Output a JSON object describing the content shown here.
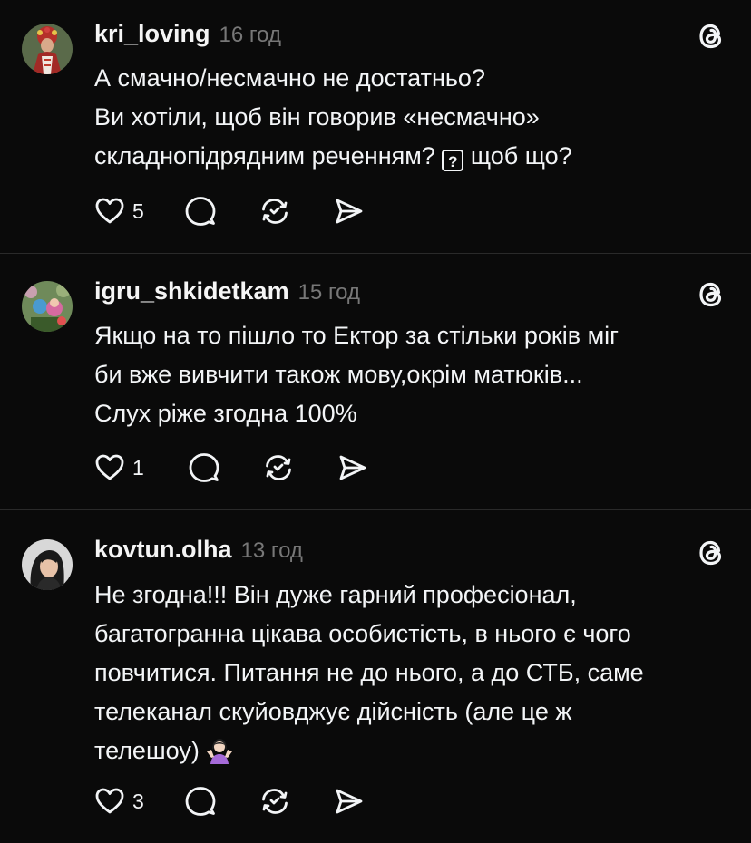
{
  "posts": [
    {
      "username": "kri_loving",
      "time": "16 год",
      "lines": [
        "А смачно/несмачно не достатньо?",
        "Ви хотіли, щоб він говорив «несмачно»",
        "складнопідрядним реченням?",
        "щоб що?"
      ],
      "unknown_glyph": "?",
      "likes": "5",
      "avatar_icon": "avatar-woman-folk-costume"
    },
    {
      "username": "igru_shkidetkam",
      "time": "15 год",
      "lines": [
        "Якщо на то пішло то Ектор за стільки років міг",
        "би вже вивчити також мову,окрім матюків...",
        "Слух ріже згодна 100%"
      ],
      "likes": "1",
      "avatar_icon": "avatar-dolls-garden"
    },
    {
      "username": "kovtun.olha",
      "time": "13 год",
      "lines": [
        "Не згодна!!! Він дуже гарний професіонал,",
        "багатогранна цікава особистість, в нього є чого",
        "повчитися. Питання не до нього, а до СТБ, саме",
        "телеканал скуйовджує дійсність (але це ж",
        "телешоу)"
      ],
      "emoji": "shrugging-woman-emoji",
      "likes": "3",
      "avatar_icon": "avatar-woman-dark-hair"
    }
  ],
  "icons": {
    "like": "heart-icon",
    "reply": "comment-icon",
    "repost": "repost-icon",
    "share": "send-icon",
    "threads": "threads-logo-icon"
  },
  "colors": {
    "background": "#0a0a0a",
    "text": "#f3f5f7",
    "muted": "#777777",
    "divider": "#2a2a2a"
  }
}
